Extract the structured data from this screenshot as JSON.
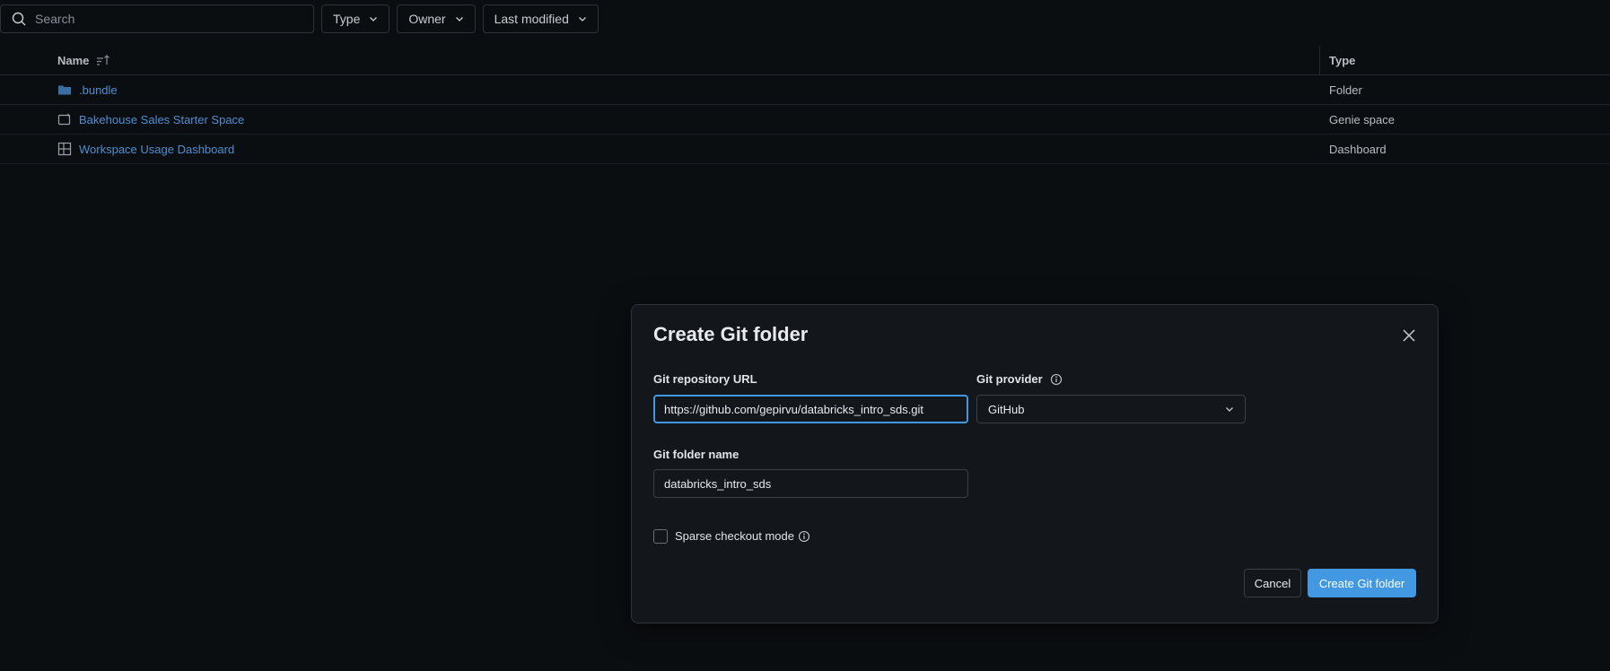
{
  "toolbar": {
    "search_placeholder": "Search",
    "filters": [
      "Type",
      "Owner",
      "Last modified"
    ]
  },
  "table": {
    "headers": {
      "name": "Name",
      "type": "Type"
    },
    "rows": [
      {
        "name": ".bundle",
        "type": "Folder",
        "icon": "folder-icon"
      },
      {
        "name": "Bakehouse Sales Starter Space",
        "type": "Genie space",
        "icon": "genie-space-icon"
      },
      {
        "name": "Workspace Usage Dashboard",
        "type": "Dashboard",
        "icon": "dashboard-icon"
      }
    ]
  },
  "modal": {
    "title": "Create Git folder",
    "repo_url_label": "Git repository URL",
    "repo_url_value": "https://github.com/gepirvu/databricks_intro_sds.git",
    "provider_label": "Git provider",
    "provider_value": "GitHub",
    "folder_name_label": "Git folder name",
    "folder_name_value": "databricks_intro_sds",
    "sparse_checkout_label": "Sparse checkout mode",
    "cancel_label": "Cancel",
    "create_label": "Create Git folder"
  },
  "colors": {
    "background": "#0b0e11",
    "modal_bg": "#13171c",
    "accent": "#4299e1",
    "link": "#4e8fd1"
  }
}
